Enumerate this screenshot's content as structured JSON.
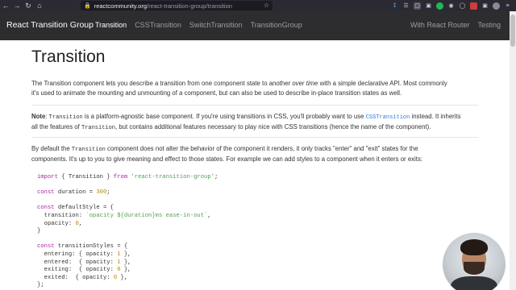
{
  "browser": {
    "url_host": "reactcommunity.org",
    "url_path": "/react-transition-group/transition"
  },
  "navbar": {
    "brand": "React Transition Group",
    "links": [
      "Transition",
      "CSSTransition",
      "SwitchTransition",
      "TransitionGroup"
    ],
    "active_link": "Transition",
    "right_links": [
      "With React Router",
      "Testing"
    ]
  },
  "page": {
    "title": "Transition",
    "intro_1": "The Transition component lets you describe a transition from one component state to another ",
    "intro_em": "over time",
    "intro_2": " with a simple declarative API. Most commonly",
    "intro_3": "it's used to animate the mounting and unmounting of a component, but can also be used to describe in-place transition states as well.",
    "note_label": "Note",
    "note_1": ": ",
    "note_code1": "Transition",
    "note_2": " is a platform-agnostic base component. If you're using transitions in CSS, you'll probably want to use ",
    "note_link": "CSSTransition",
    "note_3": " instead. It inherits",
    "note_4": "all the features of ",
    "note_code2": "Transition",
    "note_5": ", but contains additional features necessary to play nice with CSS transitions (hence the name of the component).",
    "default_1": "By default the ",
    "default_code": "Transition",
    "default_2": " component does not alter the behavior of the component it renders, it only tracks \"enter\" and \"exit\" states for the",
    "default_3": "components. It's up to you to give meaning and effect to those states. For example we can add styles to a component when it enters or exits:"
  },
  "code": {
    "l1_kw1": "import",
    "l1_mid": " { Transition } ",
    "l1_kw2": "from",
    "l1_str": " 'react-transition-group'",
    "l1_end": ";",
    "l2_kw": "const",
    "l2_mid": " duration = ",
    "l2_num": "300",
    "l2_end": ";",
    "l3_kw": "const",
    "l3_mid": " defaultStyle = {",
    "l4_a": "  transition: ",
    "l4_str": "`opacity ${duration}ms ease-in-out`",
    "l4_end": ",",
    "l5_a": "  opacity: ",
    "l5_num": "0",
    "l5_end": ",",
    "l6": "}",
    "l7_kw": "const",
    "l7_mid": " transitionStyles = {",
    "l8_a": "  entering: { opacity: ",
    "l8_num": "1",
    "l8_end": " },",
    "l9_a": "  entered:  { opacity: ",
    "l9_num": "1",
    "l9_end": " },",
    "l10_a": "  exiting:  { opacity: ",
    "l10_num": "0",
    "l10_end": " },",
    "l11_a": "  exited:  { opacity: ",
    "l11_num": "0",
    "l11_end": " },",
    "l12": "};"
  }
}
